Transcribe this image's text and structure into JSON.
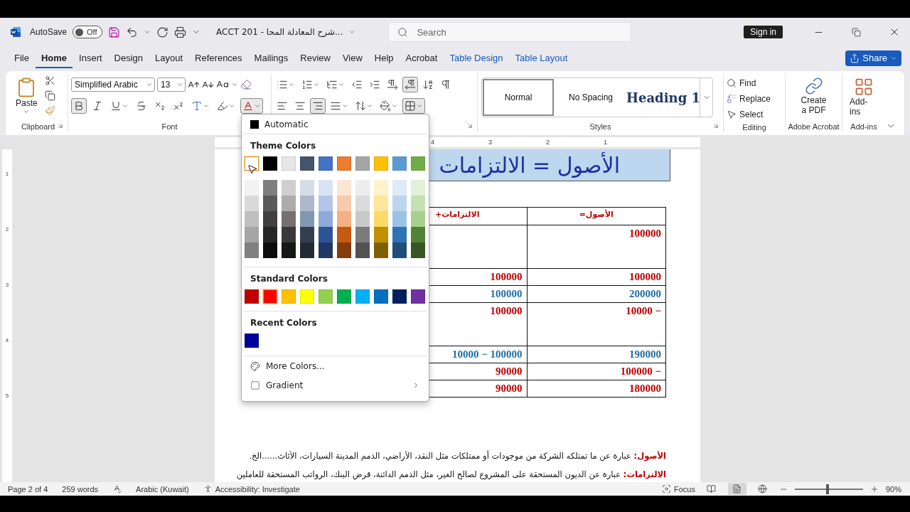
{
  "title_bar": {
    "autosave_label": "AutoSave",
    "autosave": {
      "on": false,
      "label": "Off"
    },
    "doc_title": "ACCT 201 - شرح المعادلة المحا...",
    "search_placeholder": "Search",
    "sign_in": "Sign in"
  },
  "menu_tabs": [
    {
      "label": "File",
      "selected": false,
      "kind": "normal"
    },
    {
      "label": "Home",
      "selected": true,
      "kind": "normal"
    },
    {
      "label": "Insert",
      "selected": false,
      "kind": "normal"
    },
    {
      "label": "Design",
      "selected": false,
      "kind": "normal"
    },
    {
      "label": "Layout",
      "selected": false,
      "kind": "normal"
    },
    {
      "label": "References",
      "selected": false,
      "kind": "normal"
    },
    {
      "label": "Mailings",
      "selected": false,
      "kind": "normal"
    },
    {
      "label": "Review",
      "selected": false,
      "kind": "normal"
    },
    {
      "label": "View",
      "selected": false,
      "kind": "normal"
    },
    {
      "label": "Help",
      "selected": false,
      "kind": "normal"
    },
    {
      "label": "Acrobat",
      "selected": false,
      "kind": "normal"
    },
    {
      "label": "Table Design",
      "selected": false,
      "kind": "contextual"
    },
    {
      "label": "Table Layout",
      "selected": false,
      "kind": "contextual"
    }
  ],
  "share": "Share",
  "ribbon": {
    "clipboard": {
      "label": "Clipboard",
      "paste": "Paste"
    },
    "font": {
      "label": "Font",
      "name": "Simplified Arabic",
      "size": "13",
      "format": [
        {
          "kind": "bold",
          "pressed": true
        },
        {
          "kind": "italic",
          "pressed": false
        },
        {
          "kind": "underline",
          "pressed": false
        },
        {
          "kind": "strike",
          "pressed": false
        },
        {
          "kind": "subscript",
          "pressed": false
        },
        {
          "kind": "superscript",
          "pressed": false
        },
        {
          "kind": "effects",
          "pressed": false
        },
        {
          "kind": "highlight",
          "pressed": false
        },
        {
          "kind": "font-color",
          "pressed": true
        }
      ]
    },
    "paragraph": {
      "row1": [
        {
          "kind": "bullets",
          "pressed": false
        },
        {
          "kind": "numbering",
          "pressed": false
        },
        {
          "kind": "multilevel",
          "pressed": false
        },
        {
          "kind": "outdent",
          "pressed": false
        },
        {
          "kind": "indent",
          "pressed": false
        },
        {
          "kind": "ltr",
          "pressed": false
        },
        {
          "kind": "rtl",
          "pressed": true
        },
        {
          "kind": "sort",
          "pressed": false
        },
        {
          "kind": "marks",
          "pressed": false
        }
      ],
      "row2": [
        {
          "kind": "align-left",
          "pressed": false
        },
        {
          "kind": "align-center",
          "pressed": false
        },
        {
          "kind": "align-right",
          "pressed": true
        },
        {
          "kind": "justify",
          "pressed": false
        },
        {
          "kind": "spacing",
          "pressed": false
        },
        {
          "kind": "shading",
          "pressed": false
        },
        {
          "kind": "borders",
          "pressed": true
        }
      ]
    },
    "styles": {
      "label": "Styles",
      "items": [
        {
          "label": "Normal",
          "selected": true,
          "kind": "normal"
        },
        {
          "label": "No Spacing",
          "selected": false,
          "kind": "normal"
        },
        {
          "label": "Heading 1",
          "selected": false,
          "kind": "heading"
        }
      ]
    },
    "editing": {
      "label": "Editing",
      "items": [
        {
          "kind": "find",
          "label": "Find"
        },
        {
          "kind": "replace",
          "label": "Replace"
        },
        {
          "kind": "select",
          "label": "Select"
        }
      ]
    },
    "acrobat": {
      "label": "Adobe Acrobat",
      "button": "Create a PDF"
    },
    "addins": {
      "label": "Add-ins",
      "button": "Add-ins"
    }
  },
  "rulers": {
    "horizontal": [
      "4",
      "3",
      "2",
      "1"
    ],
    "vertical": [
      "1",
      "2",
      "3",
      "4",
      "5"
    ]
  },
  "document": {
    "heading": "الأصول = الالتزامات",
    "table": {
      "columns": [
        "الأصول=",
        "الالتزامات+"
      ],
      "rows": [
        {
          "kind": "tall",
          "assets": {
            "text": "100000",
            "color": "#c00000"
          }
        },
        {
          "kind": "normal",
          "assets": {
            "text": "100000",
            "color": "#c00000"
          },
          "liabilities": {
            "text": "100000",
            "color": "#c00000"
          }
        },
        {
          "kind": "normal",
          "assets": {
            "text": "200000",
            "color": "#1f6fa3"
          },
          "liabilities": {
            "text": "100000",
            "color": "#1f6fa3"
          }
        },
        {
          "kind": "tall",
          "assets": {
            "text": "10000 −",
            "color": "#c00000"
          },
          "liabilities": {
            "text": "100000",
            "color": "#c00000"
          }
        },
        {
          "kind": "normal",
          "assets": {
            "text": "190000",
            "color": "#1f6fa3"
          },
          "liabilities": {
            "text": "10000 − 100000",
            "color": "#1f6fa3"
          }
        },
        {
          "kind": "normal",
          "assets": {
            "text": "100000 −",
            "color": "#c00000"
          },
          "liabilities": {
            "text": "90000",
            "color": "#c00000"
          }
        },
        {
          "kind": "normal",
          "assets": {
            "text": "180000",
            "color": "#c00000"
          },
          "liabilities": {
            "text": "90000",
            "color": "#c00000"
          }
        }
      ]
    },
    "paragraphs": [
      {
        "term": "الأصول:",
        "body": "عبارة عن ما تمتلكه الشركة من موجودات أو ممتلكات مثل النقد، الأراضي، الذمم المدينة السيارات، الأثاث......الخ."
      },
      {
        "term": "الالتزامات:",
        "body": "عبارة عن الديون المستحقة على المشروع لصالح الغير، مثل الذمم الدائنة، قرض البنك، الرواتب المستحقة للعاملين"
      }
    ]
  },
  "font_color_menu": {
    "automatic": "Automatic",
    "theme_title": "Theme Colors",
    "theme": [
      {
        "color": "#ffffff",
        "selected": true,
        "shades": [
          {
            "color": "#f2f2f2"
          },
          {
            "color": "#d9d9d9"
          },
          {
            "color": "#bfbfbf"
          },
          {
            "color": "#a6a6a6"
          },
          {
            "color": "#808080"
          }
        ]
      },
      {
        "color": "#000000",
        "selected": false,
        "shades": [
          {
            "color": "#7f7f7f"
          },
          {
            "color": "#595959"
          },
          {
            "color": "#404040"
          },
          {
            "color": "#262626"
          },
          {
            "color": "#0d0d0d"
          }
        ]
      },
      {
        "color": "#e7e6e6",
        "selected": false,
        "shades": [
          {
            "color": "#d0cece"
          },
          {
            "color": "#aeabab"
          },
          {
            "color": "#757171"
          },
          {
            "color": "#3a3838"
          },
          {
            "color": "#171616"
          }
        ]
      },
      {
        "color": "#44546a",
        "selected": false,
        "shades": [
          {
            "color": "#d6dce4"
          },
          {
            "color": "#adb9ca"
          },
          {
            "color": "#8497b0"
          },
          {
            "color": "#333f4f"
          },
          {
            "color": "#222a35"
          }
        ]
      },
      {
        "color": "#4472c4",
        "selected": false,
        "shades": [
          {
            "color": "#d9e2f3"
          },
          {
            "color": "#b4c6e7"
          },
          {
            "color": "#8eaadb"
          },
          {
            "color": "#2f5496"
          },
          {
            "color": "#1f3864"
          }
        ]
      },
      {
        "color": "#ed7d31",
        "selected": false,
        "shades": [
          {
            "color": "#fbe5d5"
          },
          {
            "color": "#f7caac"
          },
          {
            "color": "#f4b083"
          },
          {
            "color": "#c55a11"
          },
          {
            "color": "#833c0b"
          }
        ]
      },
      {
        "color": "#a5a5a5",
        "selected": false,
        "shades": [
          {
            "color": "#ededed"
          },
          {
            "color": "#dbdbdb"
          },
          {
            "color": "#c9c9c9"
          },
          {
            "color": "#7b7b7b"
          },
          {
            "color": "#525252"
          }
        ]
      },
      {
        "color": "#ffc000",
        "selected": false,
        "shades": [
          {
            "color": "#fff2cc"
          },
          {
            "color": "#fee599"
          },
          {
            "color": "#ffd965"
          },
          {
            "color": "#bf9000"
          },
          {
            "color": "#7f6000"
          }
        ]
      },
      {
        "color": "#5b9bd5",
        "selected": false,
        "shades": [
          {
            "color": "#deeaf6"
          },
          {
            "color": "#bdd6ee"
          },
          {
            "color": "#9cc3e5"
          },
          {
            "color": "#2e74b5"
          },
          {
            "color": "#1f4e79"
          }
        ]
      },
      {
        "color": "#70ad47",
        "selected": false,
        "shades": [
          {
            "color": "#e2efd9"
          },
          {
            "color": "#c5e0b3"
          },
          {
            "color": "#a8d08d"
          },
          {
            "color": "#538135"
          },
          {
            "color": "#375623"
          }
        ]
      }
    ],
    "standard_title": "Standard Colors",
    "standard": [
      {
        "color": "#c00000",
        "selected": false
      },
      {
        "color": "#ff0000",
        "selected": true
      },
      {
        "color": "#ffc000",
        "selected": false
      },
      {
        "color": "#ffff00",
        "selected": false
      },
      {
        "color": "#92d050",
        "selected": false
      },
      {
        "color": "#00b050",
        "selected": false
      },
      {
        "color": "#00b0f0",
        "selected": false
      },
      {
        "color": "#0070c0",
        "selected": false
      },
      {
        "color": "#002060",
        "selected": false
      },
      {
        "color": "#7030a0",
        "selected": false
      }
    ],
    "recent_title": "Recent Colors",
    "recent": [
      {
        "color": "#00009c"
      }
    ],
    "more": "More Colors...",
    "gradient": "Gradient"
  },
  "status_bar": {
    "page": "Page 2 of 4",
    "words": "259 words",
    "language": "Arabic (Kuwait)",
    "accessibility": "Accessibility: Investigate",
    "focus": "Focus",
    "views": [
      {
        "kind": "read",
        "selected": false
      },
      {
        "kind": "print",
        "selected": true
      },
      {
        "kind": "web",
        "selected": false
      }
    ],
    "zoom": {
      "level": 0.48,
      "label": "90%"
    }
  }
}
